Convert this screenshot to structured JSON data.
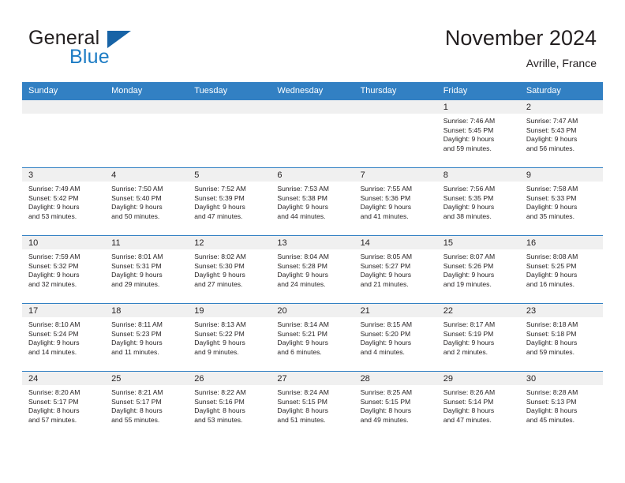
{
  "brand": {
    "word_one": "General",
    "word_two": "Blue",
    "flag_icon": "triangle-flag-icon",
    "colors": {
      "general": "#231f20",
      "blue": "#1d7cc4",
      "flag": "#1763a6"
    }
  },
  "header": {
    "title": "November 2024",
    "subtitle": "Avrille, France"
  },
  "theme": {
    "header_bg": "#3280c3",
    "daynum_bg": "#f0f0f0",
    "row_rule": "#3280c3",
    "text": "#231f20"
  },
  "weekday_headers": [
    "Sunday",
    "Monday",
    "Tuesday",
    "Wednesday",
    "Thursday",
    "Friday",
    "Saturday"
  ],
  "weeks": [
    [
      {
        "day": "",
        "empty": true,
        "sunrise": "",
        "sunset": "",
        "daylight_1": "",
        "daylight_2": ""
      },
      {
        "day": "",
        "empty": true,
        "sunrise": "",
        "sunset": "",
        "daylight_1": "",
        "daylight_2": ""
      },
      {
        "day": "",
        "empty": true,
        "sunrise": "",
        "sunset": "",
        "daylight_1": "",
        "daylight_2": ""
      },
      {
        "day": "",
        "empty": true,
        "sunrise": "",
        "sunset": "",
        "daylight_1": "",
        "daylight_2": ""
      },
      {
        "day": "",
        "empty": true,
        "sunrise": "",
        "sunset": "",
        "daylight_1": "",
        "daylight_2": ""
      },
      {
        "day": "1",
        "sunrise": "Sunrise: 7:46 AM",
        "sunset": "Sunset: 5:45 PM",
        "daylight_1": "Daylight: 9 hours",
        "daylight_2": "and 59 minutes."
      },
      {
        "day": "2",
        "sunrise": "Sunrise: 7:47 AM",
        "sunset": "Sunset: 5:43 PM",
        "daylight_1": "Daylight: 9 hours",
        "daylight_2": "and 56 minutes."
      }
    ],
    [
      {
        "day": "3",
        "sunrise": "Sunrise: 7:49 AM",
        "sunset": "Sunset: 5:42 PM",
        "daylight_1": "Daylight: 9 hours",
        "daylight_2": "and 53 minutes."
      },
      {
        "day": "4",
        "sunrise": "Sunrise: 7:50 AM",
        "sunset": "Sunset: 5:40 PM",
        "daylight_1": "Daylight: 9 hours",
        "daylight_2": "and 50 minutes."
      },
      {
        "day": "5",
        "sunrise": "Sunrise: 7:52 AM",
        "sunset": "Sunset: 5:39 PM",
        "daylight_1": "Daylight: 9 hours",
        "daylight_2": "and 47 minutes."
      },
      {
        "day": "6",
        "sunrise": "Sunrise: 7:53 AM",
        "sunset": "Sunset: 5:38 PM",
        "daylight_1": "Daylight: 9 hours",
        "daylight_2": "and 44 minutes."
      },
      {
        "day": "7",
        "sunrise": "Sunrise: 7:55 AM",
        "sunset": "Sunset: 5:36 PM",
        "daylight_1": "Daylight: 9 hours",
        "daylight_2": "and 41 minutes."
      },
      {
        "day": "8",
        "sunrise": "Sunrise: 7:56 AM",
        "sunset": "Sunset: 5:35 PM",
        "daylight_1": "Daylight: 9 hours",
        "daylight_2": "and 38 minutes."
      },
      {
        "day": "9",
        "sunrise": "Sunrise: 7:58 AM",
        "sunset": "Sunset: 5:33 PM",
        "daylight_1": "Daylight: 9 hours",
        "daylight_2": "and 35 minutes."
      }
    ],
    [
      {
        "day": "10",
        "sunrise": "Sunrise: 7:59 AM",
        "sunset": "Sunset: 5:32 PM",
        "daylight_1": "Daylight: 9 hours",
        "daylight_2": "and 32 minutes."
      },
      {
        "day": "11",
        "sunrise": "Sunrise: 8:01 AM",
        "sunset": "Sunset: 5:31 PM",
        "daylight_1": "Daylight: 9 hours",
        "daylight_2": "and 29 minutes."
      },
      {
        "day": "12",
        "sunrise": "Sunrise: 8:02 AM",
        "sunset": "Sunset: 5:30 PM",
        "daylight_1": "Daylight: 9 hours",
        "daylight_2": "and 27 minutes."
      },
      {
        "day": "13",
        "sunrise": "Sunrise: 8:04 AM",
        "sunset": "Sunset: 5:28 PM",
        "daylight_1": "Daylight: 9 hours",
        "daylight_2": "and 24 minutes."
      },
      {
        "day": "14",
        "sunrise": "Sunrise: 8:05 AM",
        "sunset": "Sunset: 5:27 PM",
        "daylight_1": "Daylight: 9 hours",
        "daylight_2": "and 21 minutes."
      },
      {
        "day": "15",
        "sunrise": "Sunrise: 8:07 AM",
        "sunset": "Sunset: 5:26 PM",
        "daylight_1": "Daylight: 9 hours",
        "daylight_2": "and 19 minutes."
      },
      {
        "day": "16",
        "sunrise": "Sunrise: 8:08 AM",
        "sunset": "Sunset: 5:25 PM",
        "daylight_1": "Daylight: 9 hours",
        "daylight_2": "and 16 minutes."
      }
    ],
    [
      {
        "day": "17",
        "sunrise": "Sunrise: 8:10 AM",
        "sunset": "Sunset: 5:24 PM",
        "daylight_1": "Daylight: 9 hours",
        "daylight_2": "and 14 minutes."
      },
      {
        "day": "18",
        "sunrise": "Sunrise: 8:11 AM",
        "sunset": "Sunset: 5:23 PM",
        "daylight_1": "Daylight: 9 hours",
        "daylight_2": "and 11 minutes."
      },
      {
        "day": "19",
        "sunrise": "Sunrise: 8:13 AM",
        "sunset": "Sunset: 5:22 PM",
        "daylight_1": "Daylight: 9 hours",
        "daylight_2": "and 9 minutes."
      },
      {
        "day": "20",
        "sunrise": "Sunrise: 8:14 AM",
        "sunset": "Sunset: 5:21 PM",
        "daylight_1": "Daylight: 9 hours",
        "daylight_2": "and 6 minutes."
      },
      {
        "day": "21",
        "sunrise": "Sunrise: 8:15 AM",
        "sunset": "Sunset: 5:20 PM",
        "daylight_1": "Daylight: 9 hours",
        "daylight_2": "and 4 minutes."
      },
      {
        "day": "22",
        "sunrise": "Sunrise: 8:17 AM",
        "sunset": "Sunset: 5:19 PM",
        "daylight_1": "Daylight: 9 hours",
        "daylight_2": "and 2 minutes."
      },
      {
        "day": "23",
        "sunrise": "Sunrise: 8:18 AM",
        "sunset": "Sunset: 5:18 PM",
        "daylight_1": "Daylight: 8 hours",
        "daylight_2": "and 59 minutes."
      }
    ],
    [
      {
        "day": "24",
        "sunrise": "Sunrise: 8:20 AM",
        "sunset": "Sunset: 5:17 PM",
        "daylight_1": "Daylight: 8 hours",
        "daylight_2": "and 57 minutes."
      },
      {
        "day": "25",
        "sunrise": "Sunrise: 8:21 AM",
        "sunset": "Sunset: 5:17 PM",
        "daylight_1": "Daylight: 8 hours",
        "daylight_2": "and 55 minutes."
      },
      {
        "day": "26",
        "sunrise": "Sunrise: 8:22 AM",
        "sunset": "Sunset: 5:16 PM",
        "daylight_1": "Daylight: 8 hours",
        "daylight_2": "and 53 minutes."
      },
      {
        "day": "27",
        "sunrise": "Sunrise: 8:24 AM",
        "sunset": "Sunset: 5:15 PM",
        "daylight_1": "Daylight: 8 hours",
        "daylight_2": "and 51 minutes."
      },
      {
        "day": "28",
        "sunrise": "Sunrise: 8:25 AM",
        "sunset": "Sunset: 5:15 PM",
        "daylight_1": "Daylight: 8 hours",
        "daylight_2": "and 49 minutes."
      },
      {
        "day": "29",
        "sunrise": "Sunrise: 8:26 AM",
        "sunset": "Sunset: 5:14 PM",
        "daylight_1": "Daylight: 8 hours",
        "daylight_2": "and 47 minutes."
      },
      {
        "day": "30",
        "sunrise": "Sunrise: 8:28 AM",
        "sunset": "Sunset: 5:13 PM",
        "daylight_1": "Daylight: 8 hours",
        "daylight_2": "and 45 minutes."
      }
    ]
  ]
}
